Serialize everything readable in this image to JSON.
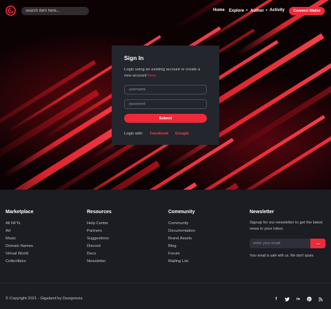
{
  "header": {
    "search_placeholder": "search item here...",
    "nav": {
      "home": "Home",
      "explore": "Explore",
      "author": "Author",
      "activity": "Activity"
    },
    "connect_wallet": "Connect Wallet"
  },
  "signin": {
    "title": "Sign In",
    "desc_before": "Login using an existing account or create a new account ",
    "desc_link": "here.",
    "username_placeholder": "username",
    "password_placeholder": "password",
    "submit": "Submit",
    "login_with": "Login with:",
    "facebook": "Facebook",
    "google": "Google"
  },
  "footer": {
    "marketplace": {
      "title": "Marketplace",
      "items": [
        "All NFTs",
        "Art",
        "Music",
        "Domain Names",
        "Virtual World",
        "Collectibles"
      ]
    },
    "resources": {
      "title": "Resources",
      "items": [
        "Help Center",
        "Partners",
        "Suggestions",
        "Discord",
        "Docs",
        "Newsletter"
      ]
    },
    "community": {
      "title": "Community",
      "items": [
        "Community",
        "Documentation",
        "Brand Assets",
        "Blog",
        "Forum",
        "Mailing List"
      ]
    },
    "newsletter": {
      "title": "Newsletter",
      "text": "Signup for our newsletter to get the latest news in your inbox.",
      "email_placeholder": "enter your email",
      "note": "Your email is safe with us. We don't spam."
    },
    "copyright": "© Copyright 2021 - Gigaland by Designesia",
    "social_icons": [
      "facebook-icon",
      "twitter-icon",
      "linkedin-icon",
      "pinterest-icon",
      "rss-icon"
    ]
  },
  "colors": {
    "accent": "#ed2a3a",
    "card_bg": "#23262d",
    "footer_bg": "#1b1d23"
  }
}
